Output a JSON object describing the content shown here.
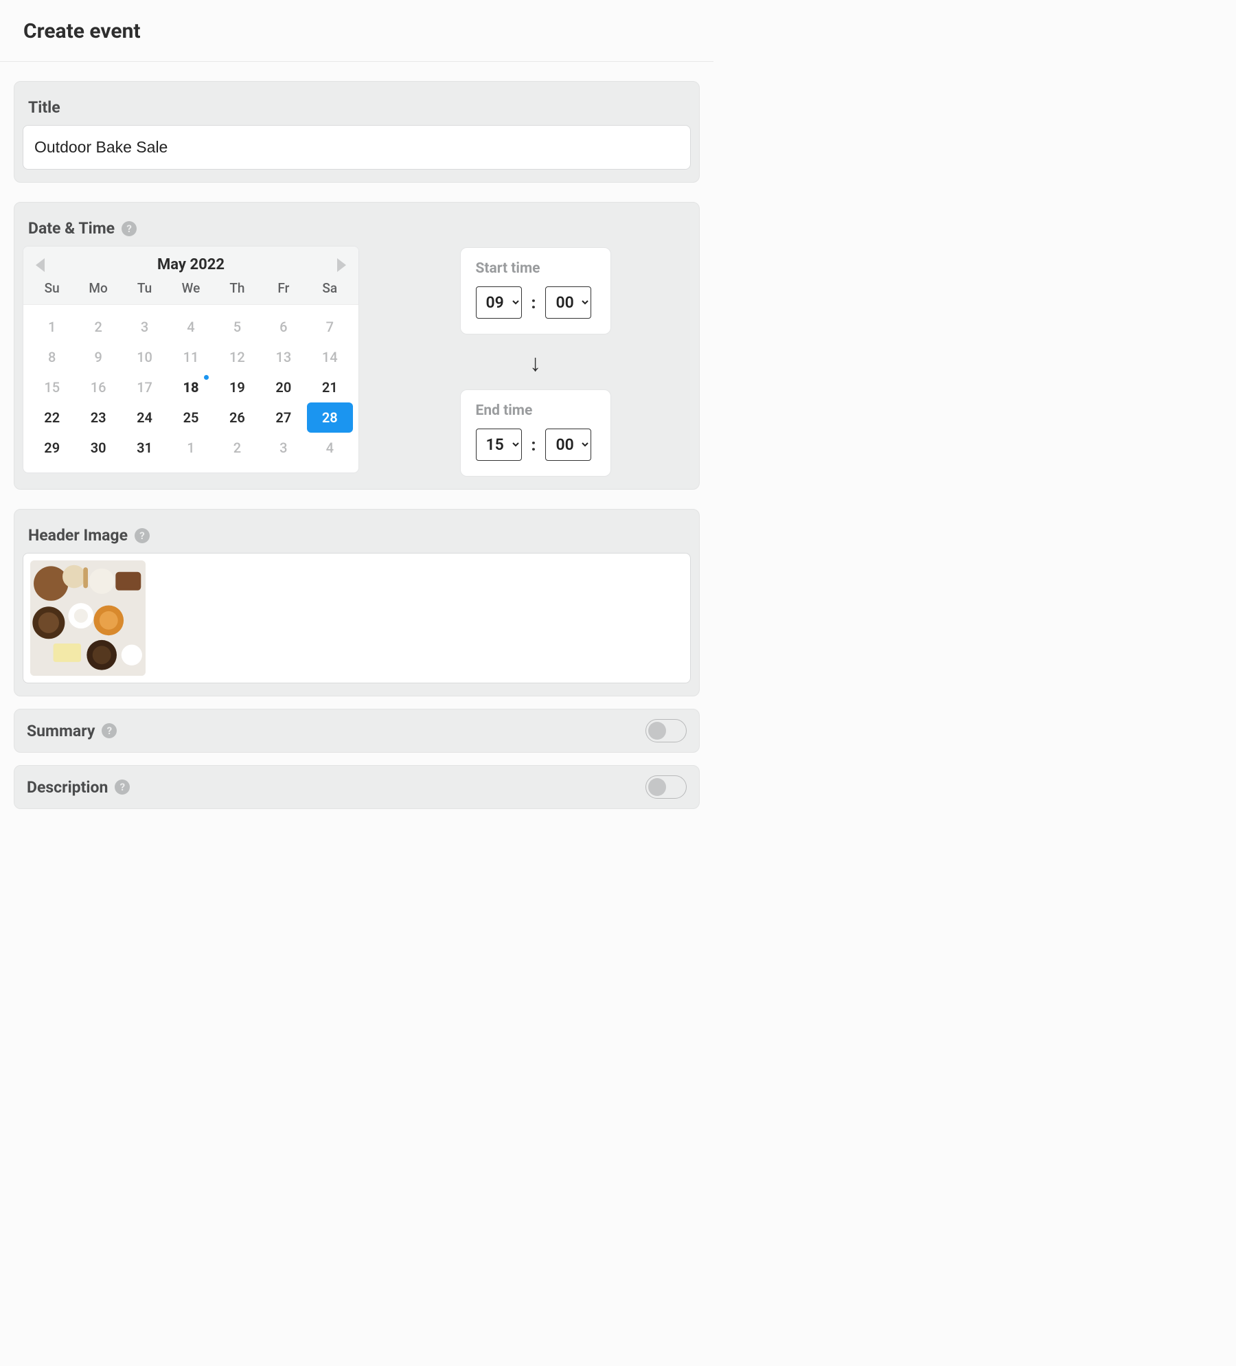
{
  "page": {
    "title": "Create event"
  },
  "titleCard": {
    "label": "Title",
    "value": "Outdoor Bake Sale"
  },
  "dateTimeCard": {
    "label": "Date & Time",
    "calendar": {
      "title": "May 2022",
      "dow": [
        "Su",
        "Mo",
        "Tu",
        "We",
        "Th",
        "Fr",
        "Sa"
      ],
      "days": [
        {
          "n": "1",
          "muted": true
        },
        {
          "n": "2",
          "muted": true
        },
        {
          "n": "3",
          "muted": true
        },
        {
          "n": "4",
          "muted": true
        },
        {
          "n": "5",
          "muted": true
        },
        {
          "n": "6",
          "muted": true
        },
        {
          "n": "7",
          "muted": true
        },
        {
          "n": "8",
          "muted": true
        },
        {
          "n": "9",
          "muted": true
        },
        {
          "n": "10",
          "muted": true
        },
        {
          "n": "11",
          "muted": true
        },
        {
          "n": "12",
          "muted": true
        },
        {
          "n": "13",
          "muted": true
        },
        {
          "n": "14",
          "muted": true
        },
        {
          "n": "15",
          "muted": true
        },
        {
          "n": "16",
          "muted": true
        },
        {
          "n": "17",
          "muted": true
        },
        {
          "n": "18",
          "today": true
        },
        {
          "n": "19"
        },
        {
          "n": "20"
        },
        {
          "n": "21"
        },
        {
          "n": "22"
        },
        {
          "n": "23"
        },
        {
          "n": "24"
        },
        {
          "n": "25"
        },
        {
          "n": "26"
        },
        {
          "n": "27"
        },
        {
          "n": "28",
          "selected": true
        },
        {
          "n": "29"
        },
        {
          "n": "30"
        },
        {
          "n": "31"
        },
        {
          "n": "1",
          "muted": true
        },
        {
          "n": "2",
          "muted": true
        },
        {
          "n": "3",
          "muted": true
        },
        {
          "n": "4",
          "muted": true
        }
      ]
    },
    "start": {
      "label": "Start time",
      "hour": "09",
      "min": "00"
    },
    "end": {
      "label": "End time",
      "hour": "15",
      "min": "00"
    }
  },
  "headerImageCard": {
    "label": "Header Image"
  },
  "summaryCard": {
    "label": "Summary",
    "on": false
  },
  "descriptionCard": {
    "label": "Description",
    "on": false
  }
}
